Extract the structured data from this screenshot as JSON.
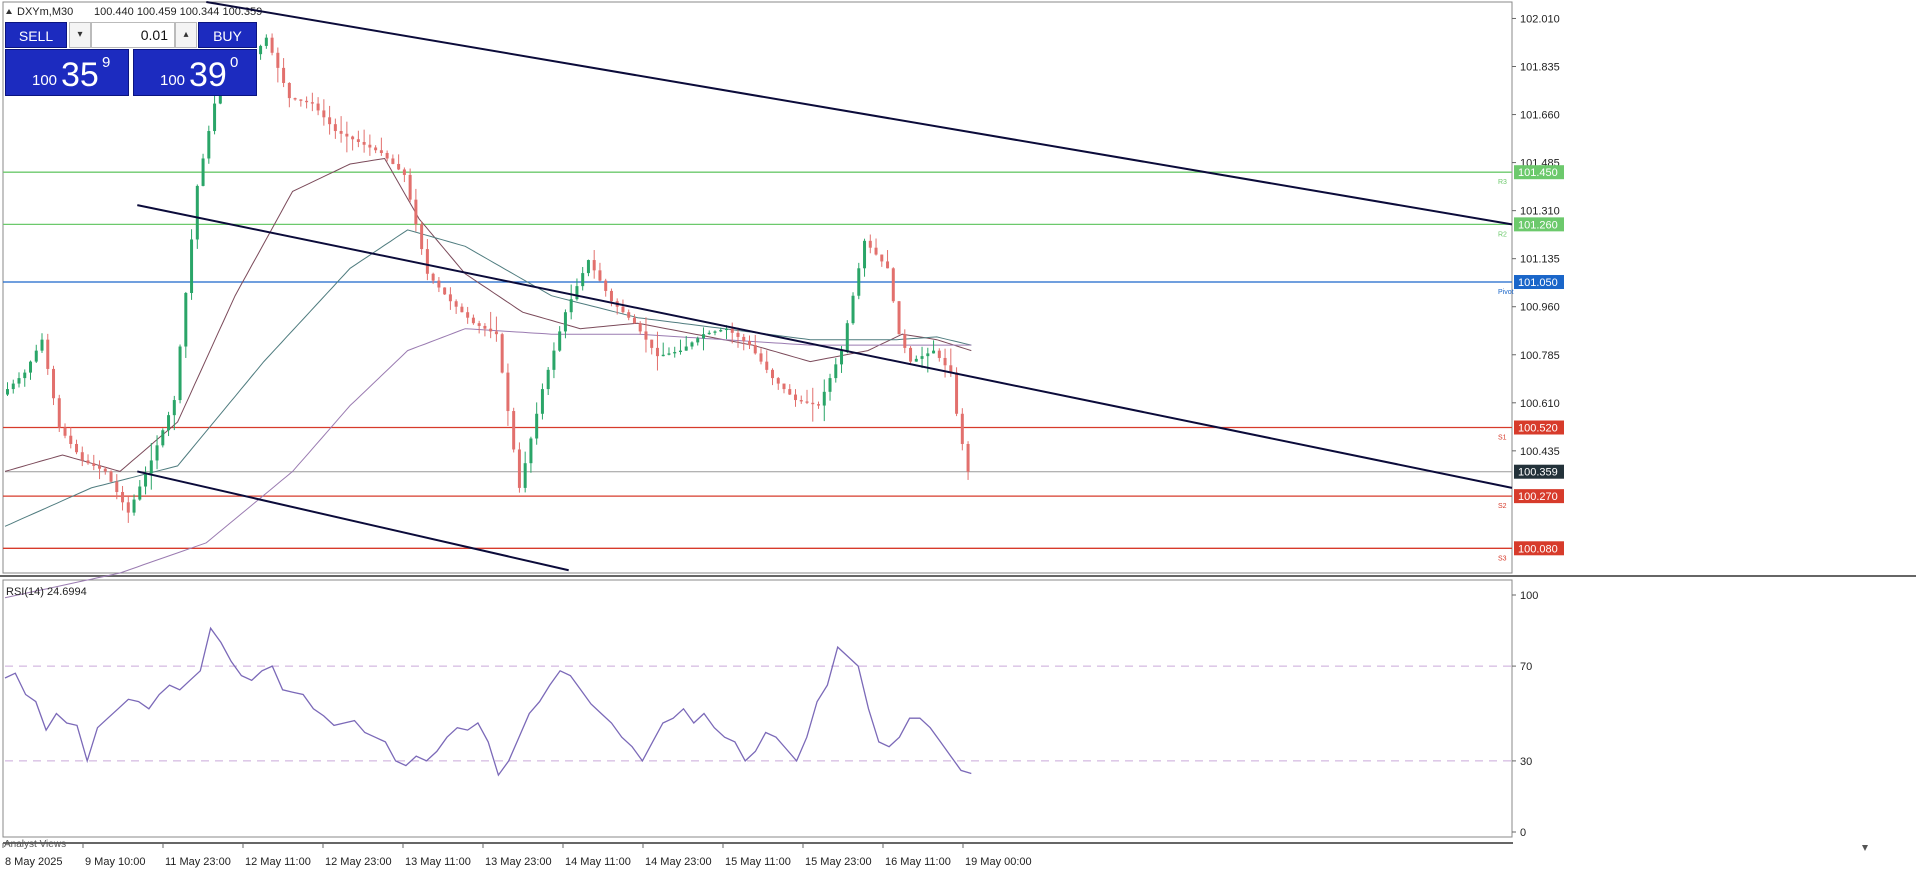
{
  "header": {
    "symbol_timeframe": "DXYm,M30",
    "ohlc": "100.440 100.459 100.344 100.359"
  },
  "trade_panel": {
    "sell_label": "SELL",
    "buy_label": "BUY",
    "lot": "0.01",
    "sell_price_small": "100",
    "sell_price_big": "35",
    "sell_price_sup": "9",
    "buy_price_small": "100",
    "buy_price_big": "39",
    "buy_price_sup": "0"
  },
  "rsi_panel": {
    "label": "RSI(14) 24.6994"
  },
  "bottom_tab": "Analyst Views",
  "colors": {
    "bull": "#2aa568",
    "bear": "#e2706d",
    "trendline": "#0b0b3a",
    "r_line": "#6cc96c",
    "s_line": "#d73b2b",
    "pivot_line": "#1a66c9",
    "rsi_line": "#7b69b8",
    "ma_slow": "#7b4a5a",
    "ma_mid": "#4f7c7f",
    "ma_long": "#9a7bb1"
  },
  "chart_data": [
    {
      "type": "candlestick",
      "symbol": "DXYm",
      "timeframe": "M30",
      "ylim": [
        99.99,
        102.07
      ],
      "yticks": [
        "102.010",
        "101.835",
        "101.660",
        "101.485",
        "101.310",
        "101.135",
        "100.960",
        "100.785",
        "100.610",
        "100.435"
      ],
      "xticks": [
        "8 May 2025",
        "9 May 10:00",
        "11 May 23:00",
        "12 May 11:00",
        "12 May 23:00",
        "13 May 11:00",
        "13 May 23:00",
        "14 May 11:00",
        "14 May 23:00",
        "15 May 11:00",
        "15 May 23:00",
        "16 May 11:00",
        "19 May 00:00"
      ],
      "current_price": {
        "value": 100.359,
        "label": "100.359"
      },
      "levels": [
        {
          "name": "R3",
          "value": 101.45,
          "label": "101.450",
          "kind": "resistance"
        },
        {
          "name": "R2",
          "value": 101.26,
          "label": "101.260",
          "kind": "resistance"
        },
        {
          "name": "Pivot",
          "value": 101.05,
          "label": "101.050",
          "kind": "pivot"
        },
        {
          "name": "S1",
          "value": 100.52,
          "label": "100.520",
          "kind": "support"
        },
        {
          "name": "S2",
          "value": 100.27,
          "label": "100.270",
          "kind": "support"
        },
        {
          "name": "S3",
          "value": 100.08,
          "label": "100.080",
          "kind": "support"
        }
      ],
      "trendlines": [
        {
          "from": [
            35,
            102.07
          ],
          "to": [
            262,
            101.26
          ]
        },
        {
          "from": [
            23,
            101.33
          ],
          "to": [
            262,
            100.3
          ]
        },
        {
          "from": [
            23,
            100.36
          ],
          "to": [
            98,
            100.0
          ]
        }
      ],
      "series": [
        {
          "kind": "price",
          "points": [
            [
              0,
              100.64
            ],
            [
              4,
              100.72
            ],
            [
              7,
              100.84
            ],
            [
              10,
              100.52
            ],
            [
              14,
              100.4
            ],
            [
              18,
              100.36
            ],
            [
              22,
              100.21
            ],
            [
              26,
              100.4
            ],
            [
              30,
              100.62
            ],
            [
              34,
              101.4
            ],
            [
              38,
              101.8
            ],
            [
              42,
              101.82
            ],
            [
              46,
              101.94
            ],
            [
              50,
              101.72
            ],
            [
              54,
              101.7
            ],
            [
              58,
              101.6
            ],
            [
              62,
              101.56
            ],
            [
              66,
              101.52
            ],
            [
              70,
              101.44
            ],
            [
              74,
              101.08
            ],
            [
              78,
              100.98
            ],
            [
              82,
              100.9
            ],
            [
              86,
              100.86
            ],
            [
              90,
              100.3
            ],
            [
              94,
              100.66
            ],
            [
              98,
              100.94
            ],
            [
              102,
              101.13
            ],
            [
              106,
              100.98
            ],
            [
              110,
              100.9
            ],
            [
              114,
              100.78
            ],
            [
              118,
              100.8
            ],
            [
              122,
              100.86
            ],
            [
              126,
              100.88
            ],
            [
              130,
              100.82
            ],
            [
              134,
              100.7
            ],
            [
              138,
              100.62
            ],
            [
              142,
              100.6
            ],
            [
              146,
              100.8
            ],
            [
              150,
              101.2
            ],
            [
              154,
              101.1
            ],
            [
              156,
              100.86
            ],
            [
              158,
              100.76
            ],
            [
              162,
              100.8
            ],
            [
              165,
              100.72
            ],
            [
              166,
              100.57
            ],
            [
              167,
              100.46
            ],
            [
              168,
              100.359
            ]
          ]
        },
        {
          "kind": "ma-slow",
          "points": [
            [
              0,
              100.36
            ],
            [
              10,
              100.42
            ],
            [
              20,
              100.36
            ],
            [
              30,
              100.54
            ],
            [
              40,
              101.0
            ],
            [
              50,
              101.38
            ],
            [
              60,
              101.48
            ],
            [
              66,
              101.5
            ],
            [
              72,
              101.28
            ],
            [
              80,
              101.08
            ],
            [
              90,
              100.94
            ],
            [
              100,
              100.88
            ],
            [
              110,
              100.9
            ],
            [
              120,
              100.86
            ],
            [
              130,
              100.82
            ],
            [
              140,
              100.76
            ],
            [
              150,
              100.8
            ],
            [
              156,
              100.86
            ],
            [
              162,
              100.84
            ],
            [
              168,
              100.8
            ]
          ]
        },
        {
          "kind": "ma-mid",
          "points": [
            [
              0,
              100.16
            ],
            [
              15,
              100.3
            ],
            [
              30,
              100.38
            ],
            [
              45,
              100.76
            ],
            [
              60,
              101.1
            ],
            [
              70,
              101.24
            ],
            [
              80,
              101.18
            ],
            [
              95,
              101.0
            ],
            [
              110,
              100.92
            ],
            [
              125,
              100.88
            ],
            [
              140,
              100.84
            ],
            [
              155,
              100.84
            ],
            [
              162,
              100.85
            ],
            [
              168,
              100.82
            ]
          ]
        },
        {
          "kind": "ma-long",
          "points": [
            [
              0,
              99.9
            ],
            [
              20,
              99.99
            ],
            [
              35,
              100.1
            ],
            [
              50,
              100.36
            ],
            [
              60,
              100.6
            ],
            [
              70,
              100.8
            ],
            [
              80,
              100.88
            ],
            [
              95,
              100.86
            ],
            [
              110,
              100.86
            ],
            [
              125,
              100.84
            ],
            [
              140,
              100.82
            ],
            [
              155,
              100.82
            ],
            [
              168,
              100.82
            ]
          ]
        }
      ]
    },
    {
      "type": "line",
      "name": "RSI(14)",
      "ylim": [
        0,
        100
      ],
      "yticks": [
        "100",
        "70",
        "30",
        "0"
      ],
      "reference_lines": [
        70,
        30
      ],
      "values": [
        65,
        67,
        58,
        55,
        43,
        50,
        46,
        45,
        30,
        44,
        48,
        52,
        56,
        55,
        52,
        58,
        62,
        60,
        64,
        68,
        86,
        80,
        72,
        66,
        64,
        68,
        70,
        60,
        59,
        58,
        52,
        49,
        45,
        46,
        47,
        42,
        40,
        38,
        30,
        28,
        32,
        30,
        34,
        40,
        44,
        43,
        46,
        38,
        24,
        30,
        40,
        50,
        55,
        62,
        68,
        66,
        60,
        54,
        50,
        46,
        40,
        36,
        30,
        38,
        46,
        48,
        52,
        46,
        50,
        44,
        40,
        38,
        30,
        34,
        42,
        40,
        35,
        30,
        40,
        55,
        62,
        78,
        74,
        70,
        52,
        38,
        36,
        40,
        48,
        48,
        44,
        38,
        32,
        26,
        24.7
      ]
    }
  ]
}
